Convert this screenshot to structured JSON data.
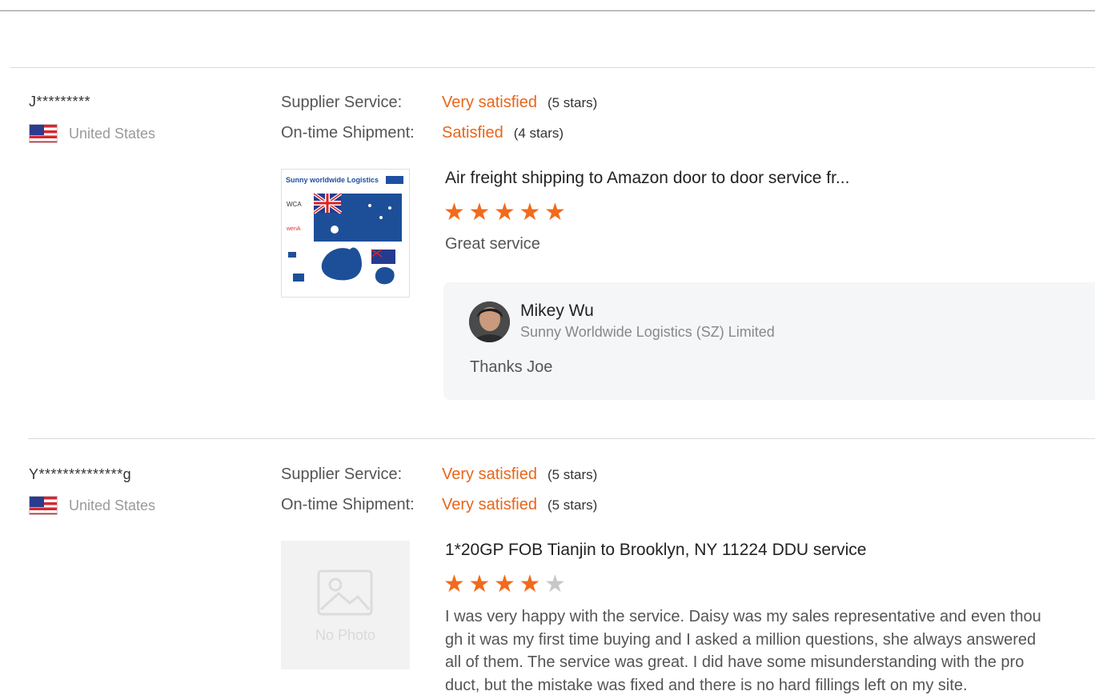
{
  "reviews": [
    {
      "buyer": "J*********",
      "country": "United States",
      "country_flag_icon": "us-flag-icon",
      "ratings": [
        {
          "label": "Supplier Service:",
          "value": "Very satisfied",
          "stars_text": "(5 stars)"
        },
        {
          "label": "On-time Shipment:",
          "value": "Satisfied",
          "stars_text": "(4 stars)"
        }
      ],
      "product_image": "product-thumbnail-logistics",
      "product_image_caption": "Sunny worldwide Logistics",
      "product_title": "Air freight shipping to Amazon door to door service fr...",
      "star_rating": 5,
      "comment": "Great service",
      "reply": {
        "name": "Mikey Wu",
        "company": "Sunny Worldwide Logistics (SZ) Limited",
        "text": "Thanks Joe"
      }
    },
    {
      "buyer": "Y**************g",
      "country": "United States",
      "country_flag_icon": "us-flag-icon",
      "ratings": [
        {
          "label": "Supplier Service:",
          "value": "Very satisfied",
          "stars_text": "(5 stars)"
        },
        {
          "label": "On-time Shipment:",
          "value": "Very satisfied",
          "stars_text": "(5 stars)"
        }
      ],
      "product_image": "no-photo-placeholder",
      "no_photo_label": "No Photo",
      "product_title": "1*20GP FOB Tianjin to Brooklyn, NY 11224 DDU service",
      "star_rating": 4,
      "comment_lines": [
        "I was very happy with the service. Daisy was my sales representative and even thou",
        "gh it was my first time buying and I asked a million questions, she always answered",
        "all of them. The service was great. I did have some misunderstanding with the pro",
        "duct, but the mistake was fixed and there is no hard fillings left on my site."
      ]
    }
  ],
  "colors": {
    "accent": "#e8651a",
    "star_on": "#f26a1b",
    "star_off": "#c7c7c7"
  }
}
